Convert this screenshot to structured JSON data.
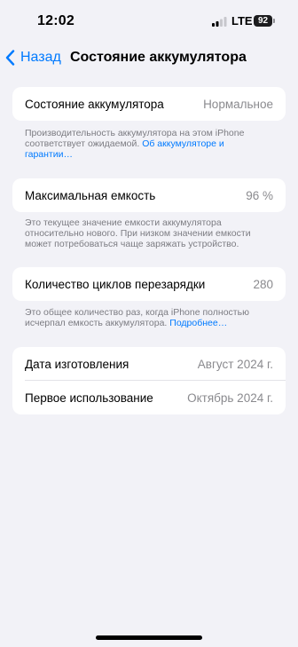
{
  "status_bar": {
    "time": "12:02",
    "network": "LTE",
    "battery": "92"
  },
  "nav": {
    "back_label": "Назад",
    "title": "Состояние аккумулятора"
  },
  "battery_health": {
    "label": "Состояние аккумулятора",
    "value": "Нормальное",
    "note": "Производительность аккумулятора на этом iPhone соответствует ожидаемой. ",
    "link": "Об аккумуляторе и гарантии…"
  },
  "max_capacity": {
    "label": "Максимальная емкость",
    "value": "96 %",
    "note": "Это текущее значение емкости аккумулятора относительно нового. При низком значении емкости может потребоваться чаще заряжать устройство."
  },
  "cycle_count": {
    "label": "Количество циклов перезарядки",
    "value": "280",
    "note": "Это общее количество раз, когда iPhone полностью исчерпал емкость аккумулятора. ",
    "link": "Подробнее…"
  },
  "dates": {
    "manufactured_label": "Дата изготовления",
    "manufactured_value": "Август 2024 г.",
    "first_use_label": "Первое использование",
    "first_use_value": "Октябрь 2024 г."
  }
}
